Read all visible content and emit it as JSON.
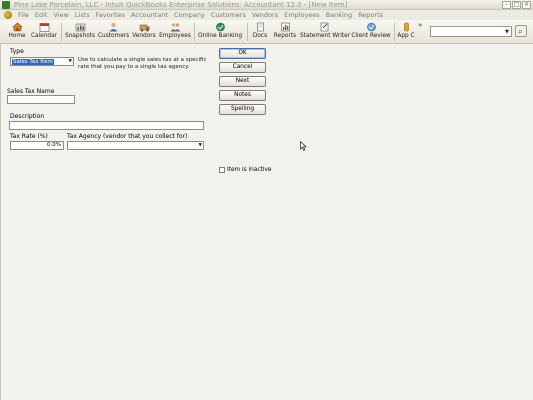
{
  "window": {
    "title": "Pine Lake Porcelain, LLC - Intuit QuickBooks Enterprise Solutions: Accountant 12.0 - [New Item]",
    "controls": [
      "–",
      "□",
      "×"
    ]
  },
  "menu": [
    "File",
    "Edit",
    "View",
    "Lists",
    "Favorites",
    "Accountant",
    "Company",
    "Customers",
    "Vendors",
    "Employees",
    "Banking",
    "Reports"
  ],
  "toolbar": {
    "home": "Home",
    "calendar": "Calendar",
    "snapshots": "Snapshots",
    "customers": "Customers",
    "vendors": "Vendors",
    "employees": "Employees",
    "online_banking": "Online Banking",
    "docs": "Docs",
    "reports": "Reports",
    "statement_writer": "Statement Writer",
    "client_review": "Client Review",
    "app_center": "App C",
    "more": "»",
    "search_placeholder": ""
  },
  "form": {
    "type_label": "Type",
    "type_value": "Sales Tax Item",
    "type_description": "Use to calculate a single sales tax at a specific rate that you pay to a single tax agency.",
    "name_label": "Sales Tax Name",
    "name_value": "",
    "description_label": "Description",
    "description_value": "",
    "tax_rate_label": "Tax Rate (%)",
    "tax_rate_value": "0.0%",
    "tax_agency_label": "Tax Agency (vendor that you collect for)",
    "tax_agency_value": "",
    "inactive_label": "Item is inactive"
  },
  "buttons": {
    "ok": "OK",
    "cancel": "Cancel",
    "next": "Next",
    "notes": "Notes",
    "spelling": "Spelling"
  },
  "colors": {
    "selection": "#316ac5",
    "title_text": "#9b9a92",
    "form_bg": "#f2f1ec"
  }
}
